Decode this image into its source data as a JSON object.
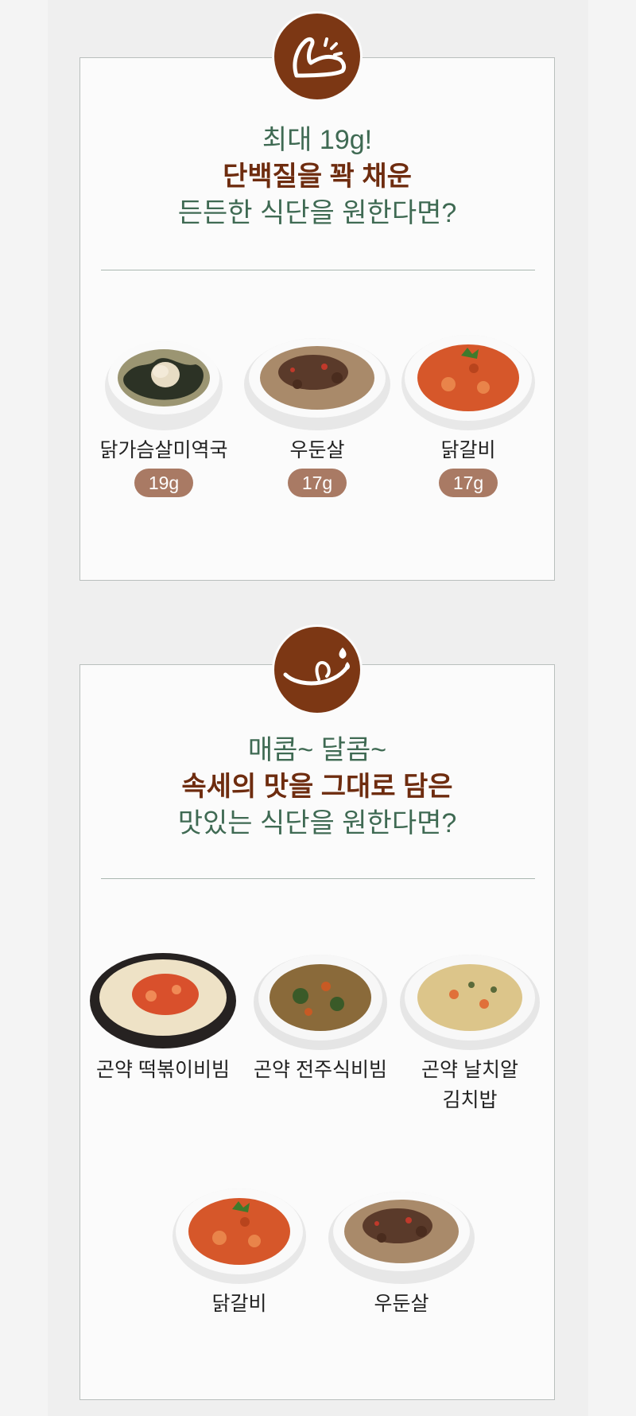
{
  "sections": [
    {
      "icon": "flexed-arm-icon",
      "headline": {
        "line1": "최대 19g!",
        "line2": "단백질을 꽉 채운",
        "line3": "든든한 식단을 원한다면?"
      },
      "items": [
        {
          "name": "닭가슴살미역국",
          "protein": "19g",
          "dish": "seaweed-soup"
        },
        {
          "name": "우둔살",
          "protein": "17g",
          "dish": "beef-rice"
        },
        {
          "name": "닭갈비",
          "protein": "17g",
          "dish": "spicy-chicken-rice"
        }
      ]
    },
    {
      "icon": "tongue-lick-icon",
      "headline": {
        "line1": "매콤~ 달콤~",
        "line2": "속세의 맛을 그대로 담은",
        "line3": "맛있는 식단을 원한다면?"
      },
      "items": [
        {
          "name": "곤약 떡볶이비빔",
          "dish": "tteokbokki-cheese"
        },
        {
          "name": "곤약 전주식비빔",
          "dish": "jeonju-bibimbap"
        },
        {
          "name_line1": "곤약 날치알",
          "name_line2": "김치밥",
          "dish": "flying-fish-roe-kimchi-rice"
        },
        {
          "name": "닭갈비",
          "dish": "spicy-chicken-rice"
        },
        {
          "name": "우둔살",
          "dish": "beef-rice"
        }
      ]
    }
  ],
  "colors": {
    "accent_brown": "#7c3714",
    "headline_green": "#3f6a53",
    "protein_pill": "#a97a64"
  }
}
